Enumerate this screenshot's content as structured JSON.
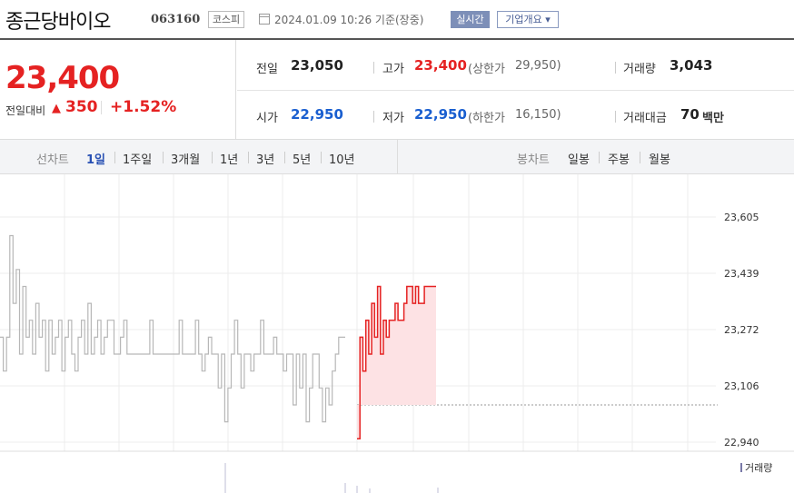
{
  "header": {
    "stock_name": "종근당바이오",
    "stock_code": "063160",
    "market": "코스피",
    "datetime": "2024.01.09 10:26 기준(장중)",
    "realtime_label": "실시간",
    "overview_label": "기업개요 ▾"
  },
  "price": {
    "current": "23,400",
    "diff_label": "전일대비",
    "diff_arrow": "▲",
    "diff_value": "350",
    "diff_rate": "+1.52%"
  },
  "summary": {
    "prev_close_label": "전일",
    "prev_close": "23,050",
    "high_label": "고가",
    "high": "23,400",
    "upper_limit_label": "(상한가",
    "upper_limit": "29,950)",
    "volume_label": "거래량",
    "volume": "3,043",
    "open_label": "시가",
    "open": "22,950",
    "low_label": "저가",
    "low": "22,950",
    "lower_limit_label": "(하한가",
    "lower_limit": "16,150)",
    "amount_label": "거래대금",
    "amount": "70",
    "amount_unit": "백만"
  },
  "tabs": {
    "line_chart_label": "선차트",
    "line_items": [
      "1일",
      "1주일",
      "3개월",
      "1년",
      "3년",
      "5년",
      "10년"
    ],
    "active_line": "1일",
    "candle_chart_label": "봉차트",
    "candle_items": [
      "일봉",
      "주봉",
      "월봉"
    ]
  },
  "chart_data": {
    "type": "line",
    "y_ticks": [
      "23,605",
      "23,439",
      "23,272",
      "23,106",
      "22,940"
    ],
    "ylim": [
      22940,
      23605
    ],
    "prev_close": 23050,
    "prev_day_series": {
      "color": "#b7b7b7",
      "values": [
        23250,
        23150,
        23250,
        23550,
        23350,
        23450,
        23200,
        23400,
        23250,
        23300,
        23200,
        23350,
        23250,
        23300,
        23150,
        23300,
        23200,
        23250,
        23300,
        23150,
        23250,
        23300,
        23200,
        23150,
        23250,
        23300,
        23200,
        23350,
        23200,
        23250,
        23300,
        23200,
        23250,
        23300,
        23300,
        23200,
        23200,
        23250,
        23300,
        23200,
        23200,
        23200,
        23200,
        23200,
        23200,
        23200,
        23300,
        23200,
        23200,
        23200,
        23200,
        23200,
        23200,
        23200,
        23200,
        23300,
        23200,
        23200,
        23200,
        23200,
        23300,
        23200,
        23150,
        23200,
        23250,
        23200,
        23200,
        23100,
        23200,
        23000,
        23100,
        23200,
        23300,
        23200,
        23100,
        23200,
        23200,
        23150,
        23200,
        23200,
        23300,
        23200,
        23200,
        23200,
        23250,
        23200,
        23200,
        23150,
        23200,
        23200,
        23050,
        23200,
        23100,
        23200,
        23000,
        23100,
        23200,
        23200,
        23100,
        23000,
        23100,
        23050,
        23150,
        23200,
        23250,
        23250,
        23250
      ]
    },
    "today_series": {
      "color": "#e52222",
      "fill": "#fde2e4",
      "values": [
        22950,
        23250,
        23150,
        23300,
        23200,
        23350,
        23250,
        23400,
        23200,
        23300,
        23250,
        23300,
        23300,
        23350,
        23300,
        23300,
        23350,
        23400,
        23400,
        23350,
        23400,
        23350,
        23350,
        23400,
        23400,
        23400,
        23400,
        23400
      ]
    },
    "volume_legend": "거래량"
  }
}
